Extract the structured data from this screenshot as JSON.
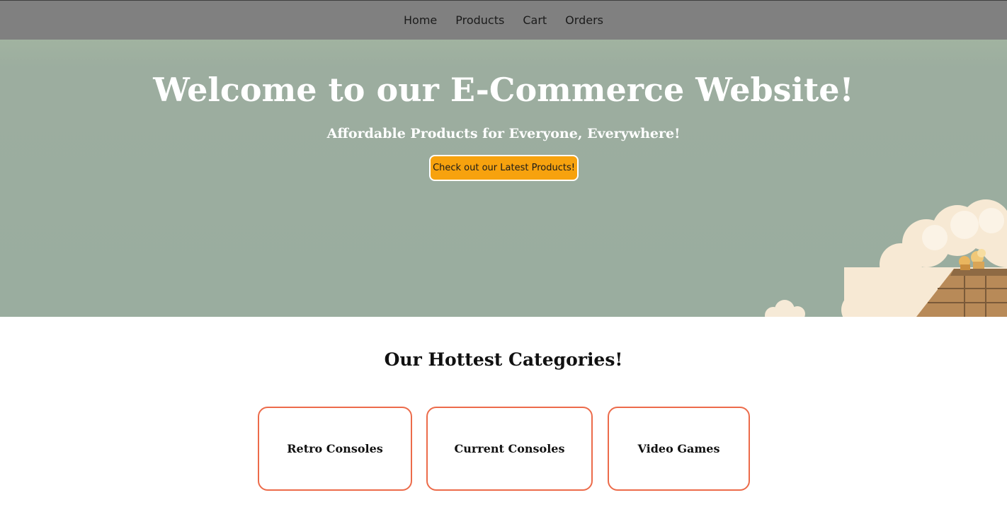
{
  "nav": {
    "items": [
      {
        "label": "Home"
      },
      {
        "label": "Products"
      },
      {
        "label": "Cart"
      },
      {
        "label": "Orders"
      }
    ]
  },
  "hero": {
    "title": "Welcome to our E-Commerce Website!",
    "subtitle": "Affordable Products for Everyone, Everywhere!",
    "cta_label": "Check out our Latest Products!"
  },
  "categories": {
    "heading": "Our Hottest Categories!",
    "items": [
      {
        "label": "Retro Consoles"
      },
      {
        "label": "Current Consoles"
      },
      {
        "label": "Video Games"
      }
    ]
  },
  "colors": {
    "navbar": "#808080",
    "hero_background": "#9aad9f",
    "cta_background": "#f7a20e",
    "card_border": "#ec6b4a"
  }
}
